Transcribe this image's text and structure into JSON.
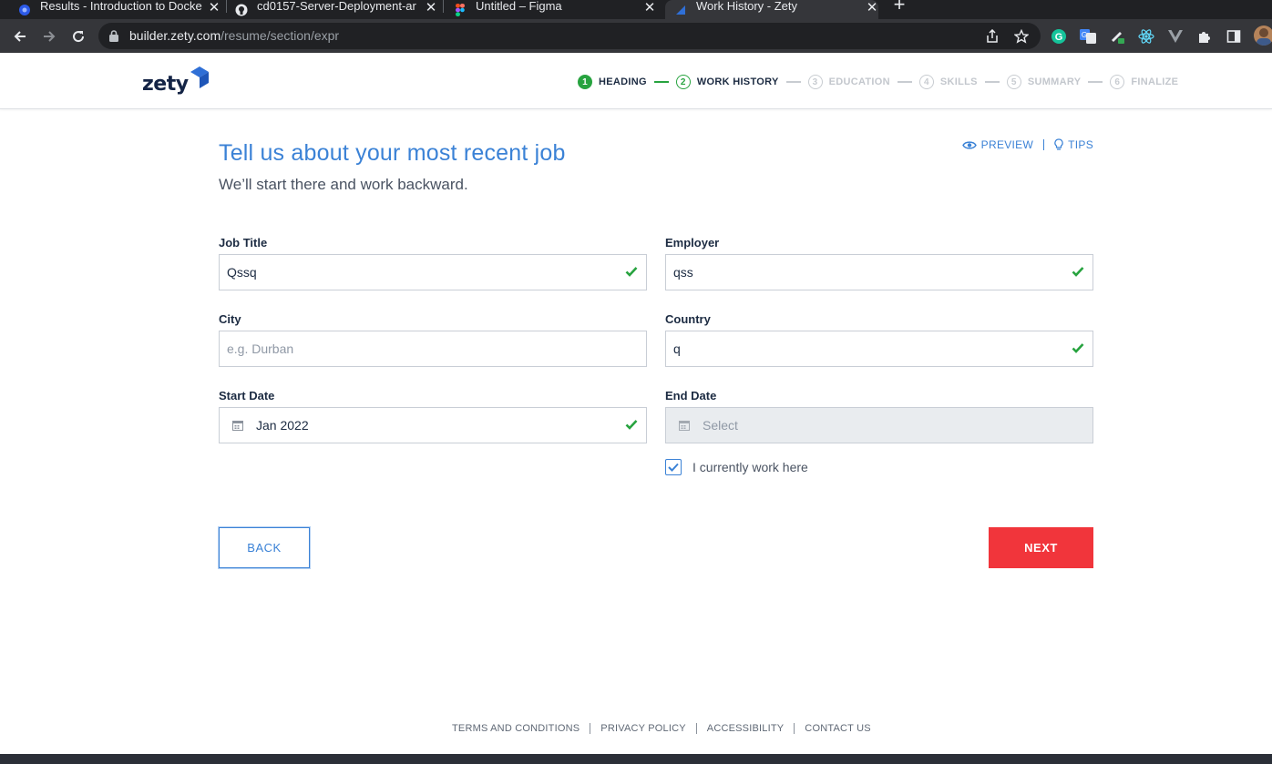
{
  "browser": {
    "tabs": [
      {
        "title": "Results - Introduction to Docke",
        "active": false
      },
      {
        "title": "cd0157-Server-Deployment-ar",
        "active": false
      },
      {
        "title": "Untitled – Figma",
        "active": false
      },
      {
        "title": "Work History - Zety",
        "active": true
      }
    ],
    "url_host": "builder.zety.com",
    "url_path": "/resume/section/expr"
  },
  "header": {
    "logo_text": "zety",
    "steps": [
      {
        "num": "1",
        "label": "HEADING",
        "state": "done"
      },
      {
        "num": "2",
        "label": "WORK HISTORY",
        "state": "current"
      },
      {
        "num": "3",
        "label": "EDUCATION",
        "state": "todo"
      },
      {
        "num": "4",
        "label": "SKILLS",
        "state": "todo"
      },
      {
        "num": "5",
        "label": "SUMMARY",
        "state": "todo"
      },
      {
        "num": "6",
        "label": "FINALIZE",
        "state": "todo"
      }
    ]
  },
  "main": {
    "title": "Tell us about your most recent job",
    "subtitle": "We’ll start there and work backward.",
    "preview_label": "PREVIEW",
    "tips_label": "TIPS"
  },
  "form": {
    "job_title": {
      "label": "Job Title",
      "value": "Qssq"
    },
    "employer": {
      "label": "Employer",
      "value": "qss"
    },
    "city": {
      "label": "City",
      "value": "",
      "placeholder": "e.g. Durban"
    },
    "country": {
      "label": "Country",
      "value": "q"
    },
    "start_date": {
      "label": "Start Date",
      "value": "Jan 2022"
    },
    "end_date": {
      "label": "End Date",
      "placeholder": "Select"
    },
    "currently_work_here": {
      "label": "I currently work here",
      "checked": true
    }
  },
  "actions": {
    "back_label": "BACK",
    "next_label": "NEXT"
  },
  "footer": {
    "links": [
      "TERMS AND CONDITIONS",
      "PRIVACY POLICY",
      "ACCESSIBILITY",
      "CONTACT US"
    ]
  },
  "colors": {
    "accent_blue": "#3b82d6",
    "success_green": "#27a33f",
    "next_red": "#f1353b",
    "brand_navy": "#142446"
  }
}
